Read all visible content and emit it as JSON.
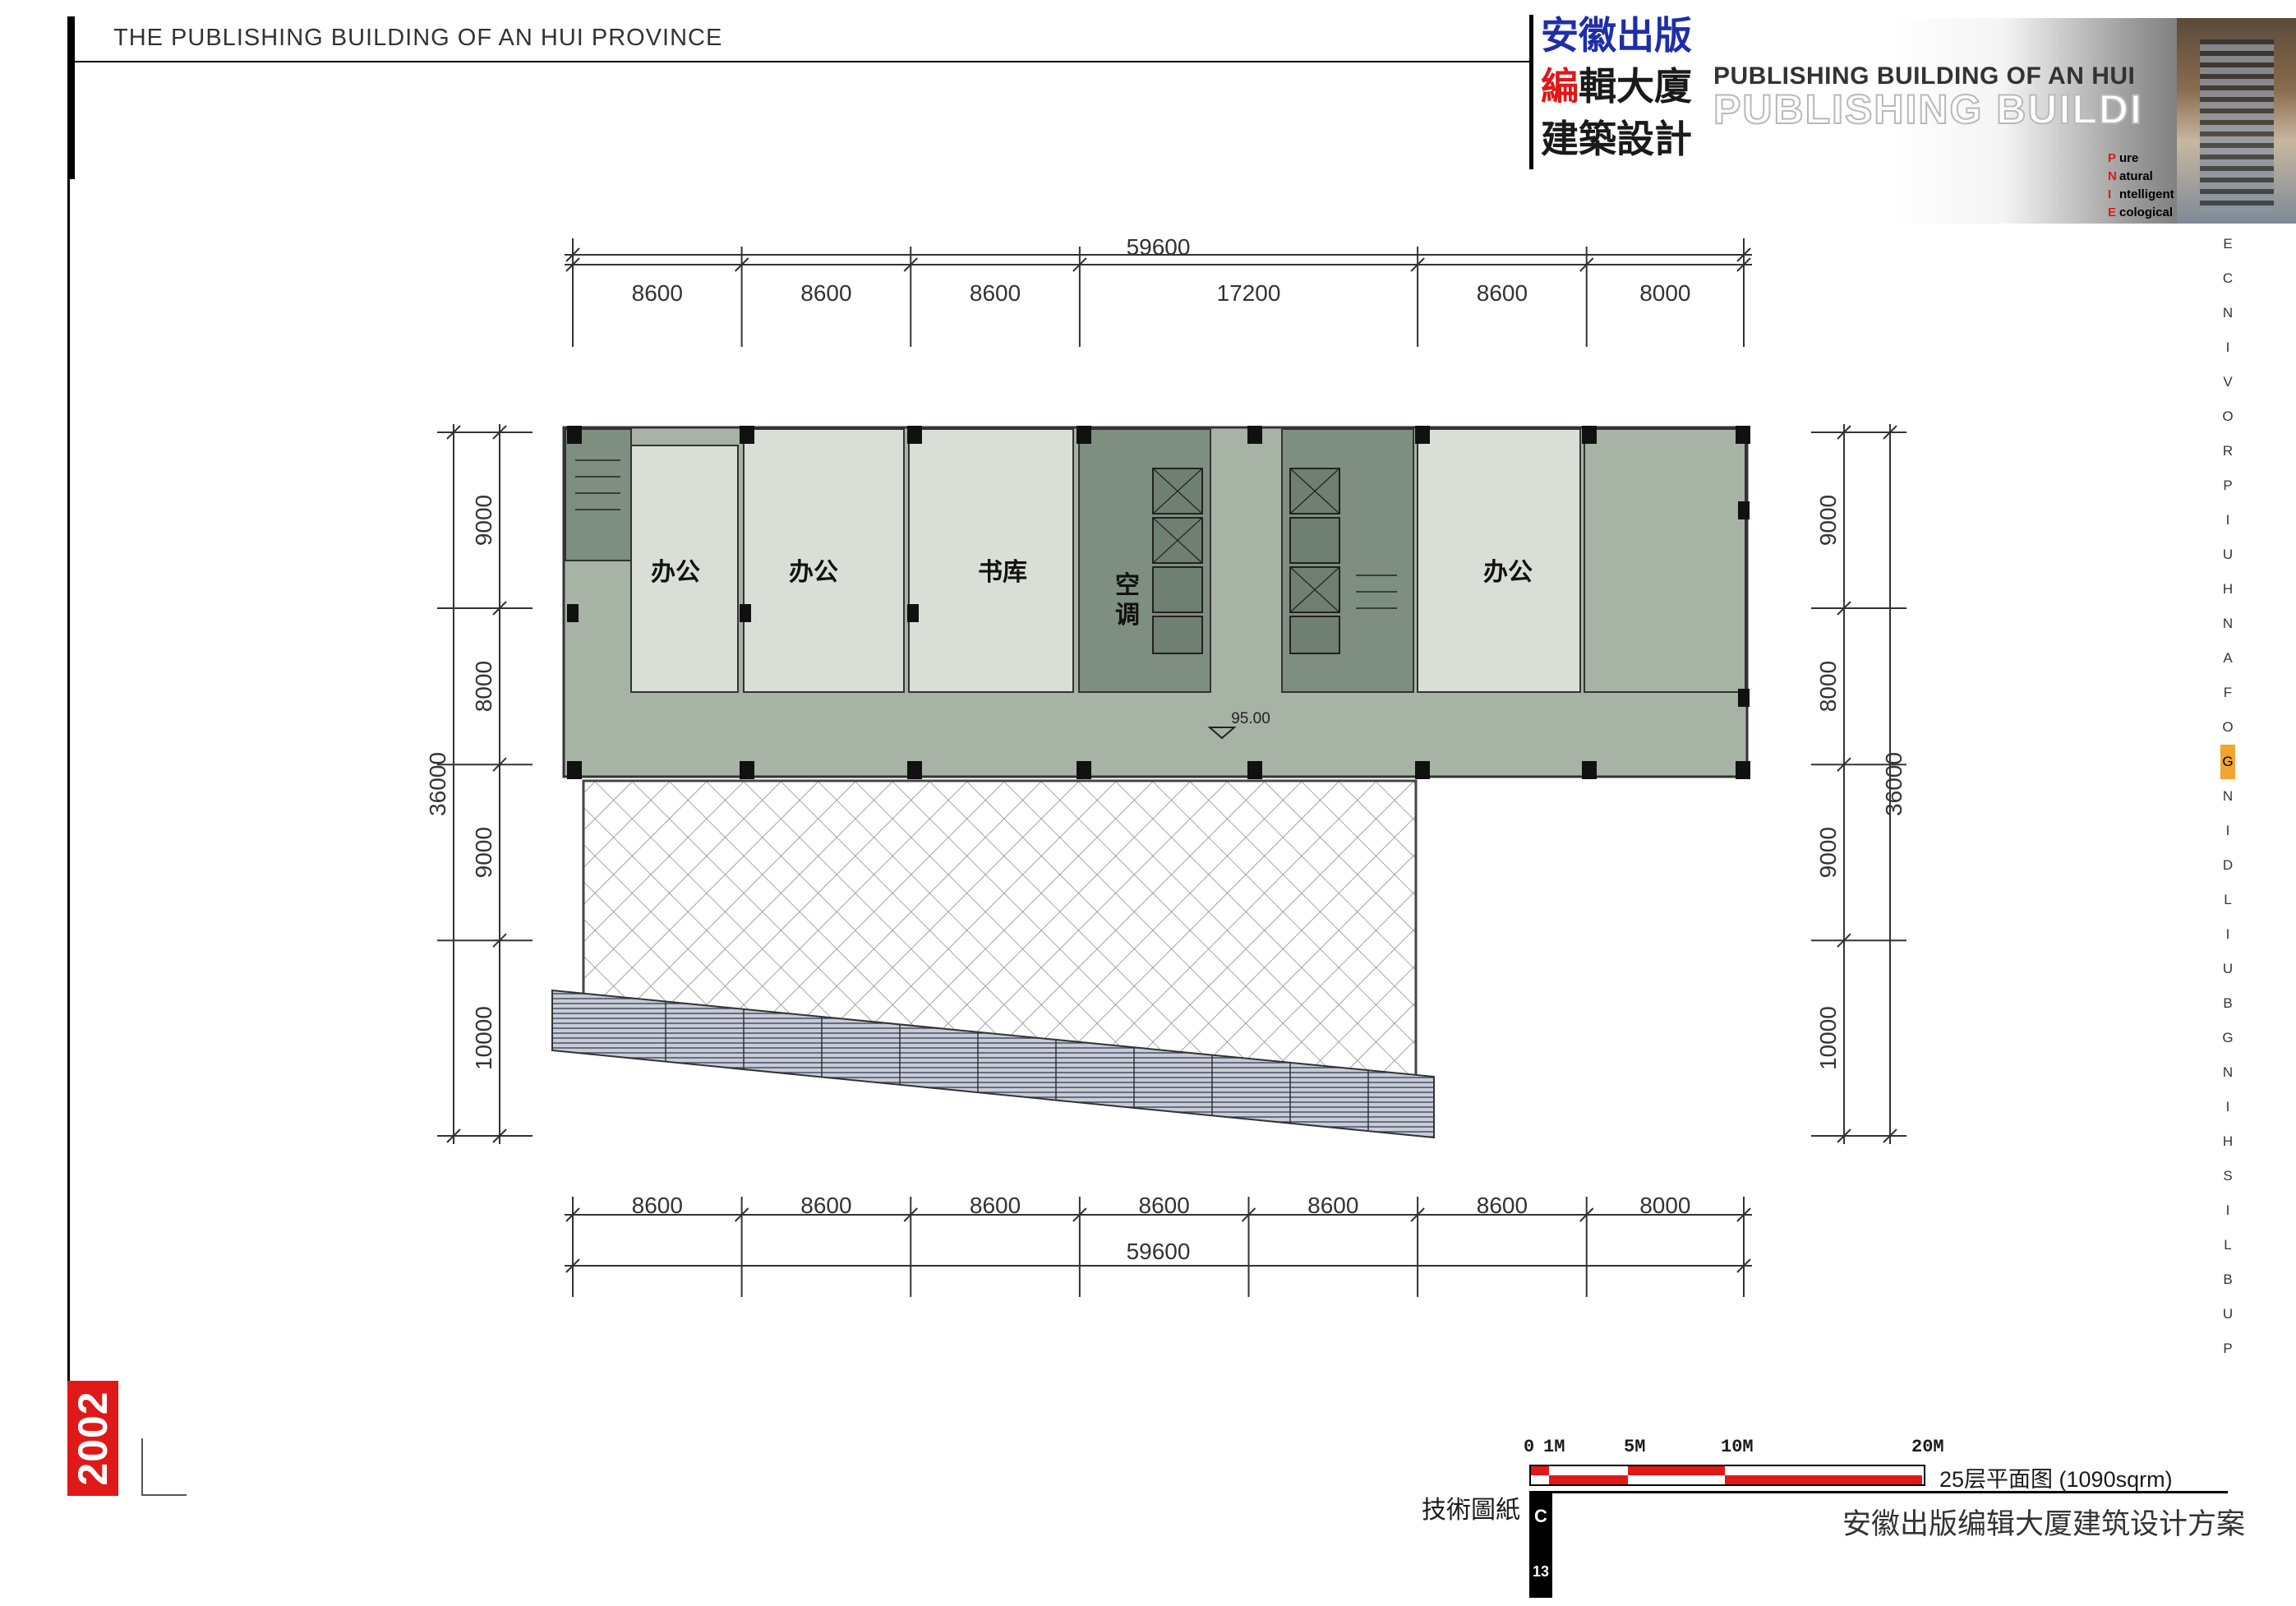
{
  "header": {
    "title": "THE PUBLISHING BUILDING OF AN HUI PROVINCE",
    "cn_line1": "安徽出版",
    "cn_line2_red": "編",
    "cn_line2_rest": "輯大廈",
    "cn_line3": "建築設計",
    "en_line1": "PUBLISHING BUILDING OF AN HUI",
    "en_line2": "PUBLISHING BUILDI",
    "pnie": [
      {
        "initial": "P",
        "rest": "ure"
      },
      {
        "initial": "N",
        "rest": "atural"
      },
      {
        "initial": "I",
        "rest": "ntelligent"
      },
      {
        "initial": "E",
        "rest": "cological"
      }
    ]
  },
  "side_vertical_text": "PUBLISHING BUILDING OF ANHUI PROVINCE",
  "side_highlight_letter": "G",
  "year": "2002",
  "dimensions": {
    "top_total": "59600",
    "top_segments": [
      "8600",
      "8600",
      "8600",
      "17200",
      "8600",
      "8000"
    ],
    "bottom_segments": [
      "8600",
      "8600",
      "8600",
      "8600",
      "8600",
      "8600",
      "8000"
    ],
    "bottom_total": "59600",
    "left_segments": [
      "9000",
      "8000",
      "9000",
      "10000"
    ],
    "left_total": "36000",
    "right_segments": [
      "9000",
      "8000",
      "9000",
      "10000"
    ],
    "right_total": "36000"
  },
  "rooms": {
    "office1": "办公",
    "office2": "办公",
    "library": "书库",
    "ac_1": "空",
    "ac_2": "调",
    "office3": "办公",
    "elevation": "95.00"
  },
  "scale": {
    "labels": [
      "0",
      "1M",
      "5M",
      "10M",
      "20M"
    ]
  },
  "plan_title": "25层平面图 (1090sqrm)",
  "tech_label": "技術圖紙",
  "sheet_letter": "C",
  "sheet_number": "13",
  "project_name": "安徽出版编辑大厦建筑设计方案",
  "colors": {
    "accent_red": "#e01818",
    "cn_blue": "#1f2ea8",
    "floor_green": "#a7b3a5",
    "core_green": "#7e8e81",
    "room_fill": "#d9dfd6",
    "highlight_orange": "#f2a531"
  }
}
